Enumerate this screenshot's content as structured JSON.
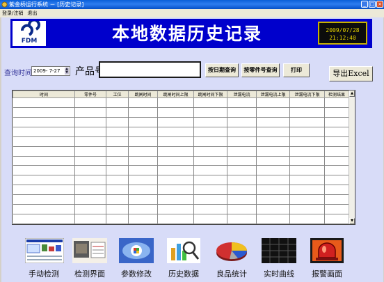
{
  "window": {
    "title": "紫金桥运行系统 － [历史记录]",
    "buttons": [
      "_",
      "□",
      "×"
    ]
  },
  "menu": [
    "登录/注销",
    "退出"
  ],
  "header": {
    "logo_text": "FDM",
    "title": "本地数据历史记录",
    "clock_date": "2009/07/28",
    "clock_time": "21:12:40"
  },
  "query": {
    "time_label": "查询时间",
    "date_value": "2009- 7-27",
    "part_label": "产品号:",
    "part_value": "",
    "btn_by_date": "按日期查询",
    "btn_by_part": "按零件号查询",
    "btn_print": "打印",
    "btn_export": "导出Excel"
  },
  "table": {
    "columns": [
      "时间",
      "零件号",
      "工位",
      "跳闸时间",
      "跳闸时间上限",
      "跳闸时间下限",
      "泄漏电流",
      "泄漏电流上限",
      "泄漏电流下限",
      "检测结果"
    ],
    "rows": []
  },
  "nav": [
    {
      "label": "手动检测",
      "icon": "manual-test-icon"
    },
    {
      "label": "检测界面",
      "icon": "test-screen-icon"
    },
    {
      "label": "参数修改",
      "icon": "parameter-edit-icon"
    },
    {
      "label": "历史数据",
      "icon": "history-data-icon"
    },
    {
      "label": "良品统计",
      "icon": "pie-chart-icon"
    },
    {
      "label": "实时曲线",
      "icon": "realtime-curve-icon"
    },
    {
      "label": "报警画面",
      "icon": "alarm-icon"
    }
  ],
  "colors": {
    "titlebar": "#0a5fd8",
    "header_bg": "#0000cc",
    "client_bg": "#d8dcf8",
    "clock_text": "#e8d400",
    "query_label": "#333399"
  }
}
